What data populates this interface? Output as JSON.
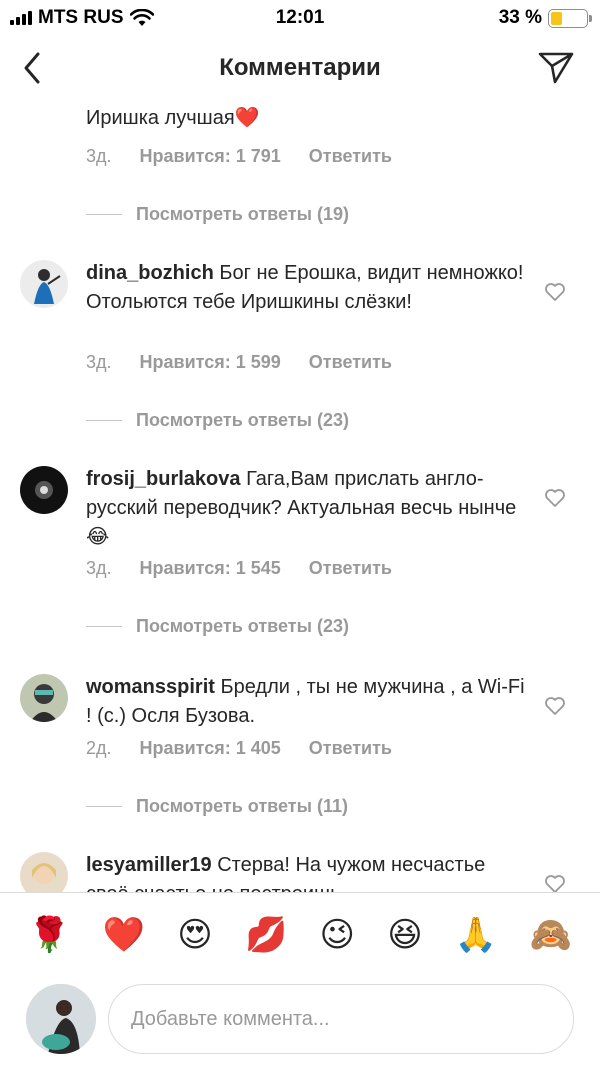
{
  "status_bar": {
    "carrier": "MTS RUS",
    "time": "12:01",
    "battery_text": "33 %",
    "battery_level": 0.33
  },
  "header": {
    "title": "Комментарии",
    "back_icon": "chevron-left-icon",
    "send_icon": "paper-plane-icon"
  },
  "comments": [
    {
      "username": "",
      "text": "Иришка лучшая❤️",
      "age": "3д.",
      "likes": "Нравится: 1 791",
      "reply": "Ответить",
      "view_replies": "Посмотреть ответы (19)"
    },
    {
      "username": "dina_bozhich",
      "text": "Бог не Ерошка, видит немножко! Отольются тебе Иришкины слёзки!",
      "age": "3д.",
      "likes": "Нравится: 1 599",
      "reply": "Ответить",
      "view_replies": "Посмотреть ответы (23)"
    },
    {
      "username": "frosij_burlakova",
      "text": "Гага,Вам прислать англо-русский переводчик? Актуальная весчь нынче😂",
      "age": "3д.",
      "likes": "Нравится: 1 545",
      "reply": "Ответить",
      "view_replies": "Посмотреть ответы (23)"
    },
    {
      "username": "womansspirit",
      "text": "Бредли , ты не мужчина , а Wi-Fi ! (с.) Осля Бузова.",
      "age": "2д.",
      "likes": "Нравится: 1 405",
      "reply": "Ответить",
      "view_replies": "Посмотреть ответы (11)"
    },
    {
      "username": "lesyamiller19",
      "text": "Стерва! На чужом несчастье своё счастье не построишь"
    }
  ],
  "emoji_bar": [
    "🌹",
    "❤️",
    "😍",
    "💋",
    "😉",
    "😆",
    "🙏",
    "🙈"
  ],
  "input": {
    "placeholder": "Добавьте коммента..."
  },
  "colors": {
    "text": "#262626",
    "secondary": "#999999",
    "divider": "#dbdbdb",
    "battery": "#f5c518"
  }
}
